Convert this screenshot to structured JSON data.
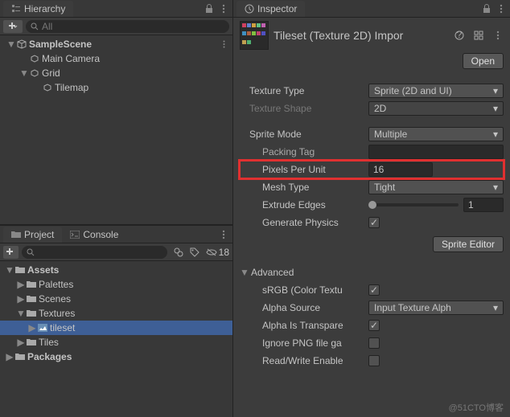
{
  "hierarchy": {
    "tab": "Hierarchy",
    "search_placeholder": "All",
    "root": "SampleScene",
    "items": [
      {
        "label": "Main Camera",
        "indent": 1
      },
      {
        "label": "Grid",
        "indent": 1,
        "expanded": true
      },
      {
        "label": "Tilemap",
        "indent": 2
      }
    ]
  },
  "project": {
    "tab_project": "Project",
    "tab_console": "Console",
    "hidden_count": "18",
    "items": [
      {
        "label": "Assets",
        "indent": 0,
        "expanded": true,
        "bold": true
      },
      {
        "label": "Palettes",
        "indent": 1,
        "expanded": false
      },
      {
        "label": "Scenes",
        "indent": 1,
        "expanded": false
      },
      {
        "label": "Textures",
        "indent": 1,
        "expanded": true
      },
      {
        "label": "tileset",
        "indent": 2,
        "selected": true,
        "expanded": false,
        "icon": "image"
      },
      {
        "label": "Tiles",
        "indent": 1,
        "expanded": false
      },
      {
        "label": "Packages",
        "indent": 0,
        "expanded": false,
        "bold": true
      }
    ]
  },
  "inspector": {
    "tab": "Inspector",
    "title": "Tileset (Texture 2D) Impor",
    "open_btn": "Open",
    "texture_type": {
      "label": "Texture Type",
      "value": "Sprite (2D and UI)"
    },
    "texture_shape": {
      "label": "Texture Shape",
      "value": "2D"
    },
    "sprite_mode": {
      "label": "Sprite Mode",
      "value": "Multiple"
    },
    "packing_tag": {
      "label": "Packing Tag",
      "value": ""
    },
    "pixels_per_unit": {
      "label": "Pixels Per Unit",
      "value": "16"
    },
    "mesh_type": {
      "label": "Mesh Type",
      "value": "Tight"
    },
    "extrude_edges": {
      "label": "Extrude Edges",
      "value": "1"
    },
    "generate_physics": {
      "label": "Generate Physics",
      "checked": true
    },
    "sprite_editor_btn": "Sprite Editor",
    "advanced": {
      "label": "Advanced"
    },
    "srgb": {
      "label": "sRGB (Color Textu",
      "checked": true
    },
    "alpha_source": {
      "label": "Alpha Source",
      "value": "Input Texture Alph"
    },
    "alpha_transparency": {
      "label": "Alpha Is Transpare",
      "checked": true
    },
    "ignore_png": {
      "label": "Ignore PNG file ga",
      "checked": false
    },
    "read_write": {
      "label": "Read/Write Enable",
      "checked": false
    }
  },
  "watermark": "@51CTO博客"
}
